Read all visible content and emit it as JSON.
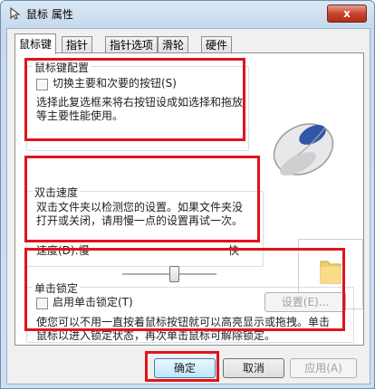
{
  "window": {
    "title": "鼠标 属性",
    "close_glyph": "x"
  },
  "tabs": [
    {
      "label": "鼠标键",
      "active": true
    },
    {
      "label": "指针",
      "active": false
    },
    {
      "label": "指针选项",
      "active": false
    },
    {
      "label": "滑轮",
      "active": false
    },
    {
      "label": "硬件",
      "active": false
    }
  ],
  "button_config": {
    "legend": "鼠标键配置",
    "swap_label": "切换主要和次要的按钮(S)",
    "swap_checked": false,
    "description": [
      "选择此复选框来将右按钮设成如选择和拖放",
      "等主要性能使用。"
    ]
  },
  "double_click": {
    "legend": "双击速度",
    "description": [
      "双击文件夹以检测您的设置。如果文件夹没",
      "打开或关闭，请用慢一点的设置再试一次。"
    ],
    "speed_label": "速度(D):慢",
    "fast_label": "快",
    "speed_level": 0.55
  },
  "click_lock": {
    "legend": "单击锁定",
    "enable_label": "启用单击锁定(T)",
    "enable_checked": false,
    "settings_button": "设置(E)...",
    "description": [
      "使您可以不用一直按着鼠标按钮就可以高亮显示或拖拽。单击",
      "鼠标以进入锁定状态，再次单击鼠标可解除锁定。"
    ]
  },
  "footer": {
    "ok": "确定",
    "cancel": "取消",
    "apply": "应用(A)"
  },
  "colors": {
    "highlight_box": "#e0141b",
    "window_frame": "#6d8fb1"
  },
  "icons": {
    "window": "mouse-pointer-icon",
    "mouse_picture": "mouse-illustration",
    "folder": "folder-icon"
  }
}
